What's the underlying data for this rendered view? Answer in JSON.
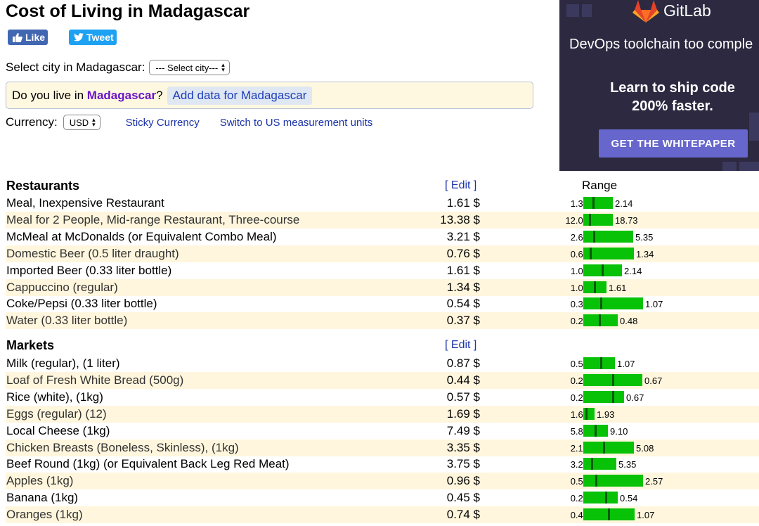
{
  "page": {
    "title": "Cost of Living in Madagascar",
    "like_label": "Like",
    "tweet_label": "Tweet",
    "select_city_label": "Select city in Madagascar:",
    "select_city_value": "--- Select city---",
    "live_prefix": "Do you live in ",
    "live_country": "Madagascar",
    "live_suffix": "?",
    "add_data_label": "Add data for Madagascar",
    "currency_label": "Currency:",
    "currency_value": "USD",
    "sticky_currency_label": "Sticky Currency",
    "us_units_label": "Switch to US measurement units"
  },
  "ad": {
    "brand": "GitLab",
    "tagline": "DevOps toolchain too comple",
    "headline_line1": "Learn to ship code",
    "headline_line2": "200% faster.",
    "cta": "GET THE WHITEPAPER"
  },
  "table": {
    "edit_label": "[ Edit ]",
    "range_header": "Range",
    "sections": [
      {
        "title": "Restaurants",
        "rows": [
          {
            "name": "Meal, Inexpensive Restaurant",
            "price": "1.61 $",
            "min": "1.34",
            "max": "2.14",
            "pos": 0.34
          },
          {
            "name": "Meal for 2 People, Mid-range Restaurant, Three-course",
            "price": "13.38 $",
            "min": "12.04",
            "max": "18.73",
            "pos": 0.2
          },
          {
            "name": "McMeal at McDonalds (or Equivalent Combo Meal)",
            "price": "3.21 $",
            "min": "2.68",
            "max": "5.35",
            "pos": 0.2
          },
          {
            "name": "Domestic Beer (0.5 liter draught)",
            "price": "0.76 $",
            "min": "0.67",
            "max": "1.34",
            "pos": 0.13
          },
          {
            "name": "Imported Beer (0.33 liter bottle)",
            "price": "1.61 $",
            "min": "1.07",
            "max": "2.14",
            "pos": 0.5
          },
          {
            "name": "Cappuccino (regular)",
            "price": "1.34 $",
            "min": "1.07",
            "max": "1.61",
            "pos": 0.5
          },
          {
            "name": "Coke/Pepsi (0.33 liter bottle)",
            "price": "0.54 $",
            "min": "0.32",
            "max": "1.07",
            "pos": 0.29
          },
          {
            "name": "Water (0.33 liter bottle)",
            "price": "0.37 $",
            "min": "0.27",
            "max": "0.48",
            "pos": 0.48
          }
        ]
      },
      {
        "title": "Markets",
        "rows": [
          {
            "name": "Milk (regular), (1 liter)",
            "price": "0.87 $",
            "min": "0.59",
            "max": "1.07",
            "pos": 0.58
          },
          {
            "name": "Loaf of Fresh White Bread (500g)",
            "price": "0.44 $",
            "min": "0.21",
            "max": "0.67",
            "pos": 0.5
          },
          {
            "name": "Rice (white), (1kg)",
            "price": "0.57 $",
            "min": "0.27",
            "max": "0.67",
            "pos": 0.75
          },
          {
            "name": "Eggs (regular) (12)",
            "price": "1.69 $",
            "min": "1.61",
            "max": "1.93",
            "pos": 0.25
          },
          {
            "name": "Local Cheese (1kg)",
            "price": "7.49 $",
            "min": "5.89",
            "max": "9.10",
            "pos": 0.5
          },
          {
            "name": "Chicken Breasts (Boneless, Skinless), (1kg)",
            "price": "3.35 $",
            "min": "2.14",
            "max": "5.08",
            "pos": 0.41
          },
          {
            "name": "Beef Round (1kg) (or Equivalent Back Leg Red Meat)",
            "price": "3.75 $",
            "min": "3.21",
            "max": "5.35",
            "pos": 0.25
          },
          {
            "name": "Apples (1kg)",
            "price": "0.96 $",
            "min": "0.54",
            "max": "2.57",
            "pos": 0.21
          },
          {
            "name": "Banana (1kg)",
            "price": "0.45 $",
            "min": "0.27",
            "max": "0.54",
            "pos": 0.67
          },
          {
            "name": "Oranges (1kg)",
            "price": "0.74 $",
            "min": "0.40",
            "max": "1.07",
            "pos": 0.5
          }
        ]
      }
    ]
  },
  "colors": {
    "range_bar": "#07c207",
    "range_marker": "#055a05",
    "alt_row": "#fff6dd",
    "link": "#1c33a8",
    "country_highlight": "#6a14c8"
  },
  "icons": [
    "facebook-thumb-icon",
    "twitter-bird-icon",
    "select-arrows-icon",
    "gitlab-logo-icon"
  ]
}
